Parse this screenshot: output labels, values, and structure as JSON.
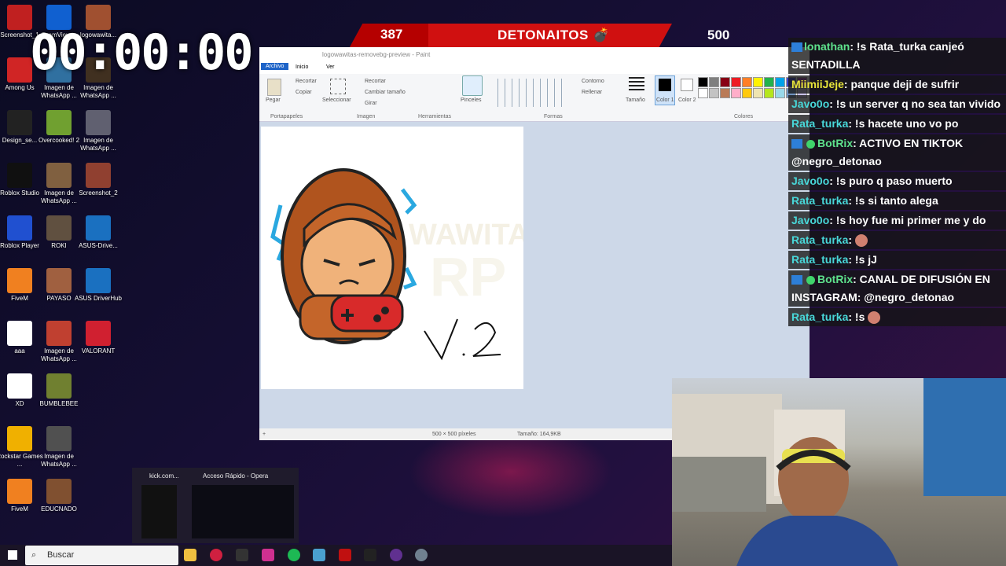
{
  "desktop_icons": [
    {
      "label": "Screenshot_1",
      "color": "#c02020"
    },
    {
      "label": "Among Us",
      "color": "#d02525"
    },
    {
      "label": "Design_se...",
      "color": "#222222"
    },
    {
      "label": "Roblox Studio",
      "color": "#101010"
    },
    {
      "label": "Roblox Player",
      "color": "#2050d0"
    },
    {
      "label": "FiveM",
      "color": "#f08020"
    },
    {
      "label": "aaa",
      "color": "#ffffff"
    },
    {
      "label": "XD",
      "color": "#ffffff"
    },
    {
      "label": "Rockstar Games ...",
      "color": "#f0b000"
    },
    {
      "label": "FiveM",
      "color": "#f08020"
    },
    {
      "label": "TeamViewer",
      "color": "#1060d0"
    },
    {
      "label": "Imagen de WhatsApp ...",
      "color": "#3070a0"
    },
    {
      "label": "Overcooked! 2",
      "color": "#70a030"
    },
    {
      "label": "Imagen de WhatsApp ...",
      "color": "#806040"
    },
    {
      "label": "ROKI",
      "color": "#605040"
    },
    {
      "label": "PAYASO",
      "color": "#a06040"
    },
    {
      "label": "Imagen de WhatsApp ...",
      "color": "#c04030"
    },
    {
      "label": "BUMBLEBEE",
      "color": "#708030"
    },
    {
      "label": "Imagen de WhatsApp ...",
      "color": "#505050"
    },
    {
      "label": "EDUCNADO",
      "color": "#805030"
    },
    {
      "label": "logowawita...",
      "color": "#a05030"
    },
    {
      "label": "Imagen de WhatsApp ...",
      "color": "#403020"
    },
    {
      "label": "Imagen de WhatsApp ...",
      "color": "#606070"
    },
    {
      "label": "Screenshot_2",
      "color": "#904030"
    },
    {
      "label": "ASUS-Drive...",
      "color": "#1a70c0"
    },
    {
      "label": "ASUS DriverHub",
      "color": "#1a70c0"
    },
    {
      "label": "VALORANT",
      "color": "#d02030"
    }
  ],
  "timer": "00:00:00",
  "scorebar": {
    "left": "387",
    "title": "DETONAITOS 💣",
    "right": "500"
  },
  "paint": {
    "title": "logowawitas-removebg-preview - Paint",
    "menu": [
      "Archivo",
      "Inicio",
      "Ver"
    ],
    "groups": [
      "Portapapeles",
      "Imagen",
      "Herramientas",
      "Formas",
      "Colores"
    ],
    "clipboard": {
      "paste": "Pegar",
      "cut": "Recortar",
      "copy": "Copiar"
    },
    "image": {
      "select": "Seleccionar",
      "crop": "Recortar",
      "resize": "Cambiar tamaño",
      "rotate": "Girar"
    },
    "brushes": "Pinceles",
    "outline": "Contorno",
    "fill": "Rellenar",
    "size": "Tamaño",
    "color1": "Color 1",
    "color2": "Color 2",
    "palette": [
      "#000000",
      "#7f7f7f",
      "#880015",
      "#ed1c24",
      "#ff7f27",
      "#fff200",
      "#22b14c",
      "#00a2e8",
      "#3f48cc",
      "#a349a4",
      "#ffffff",
      "#c3c3c3",
      "#b97a57",
      "#ffaec9",
      "#ffc90e",
      "#efe4b0",
      "#b5e61d",
      "#99d9ea",
      "#7092be",
      "#c8bfe7"
    ],
    "status_size": "500 × 500 píxeles",
    "status_file": "Tamaño: 164,9KB",
    "watermark": "WAWITAS RP",
    "handwritten": "V. 2"
  },
  "chat": [
    {
      "user": "lonathan",
      "cls": "g",
      "text": ": !s Rata_turka canjeó SENTADILLA",
      "badge": true
    },
    {
      "user": "MiimiiJeje",
      "cls": "y",
      "text": ": panque deji de sufrir"
    },
    {
      "user": "Javo0o",
      "cls": "c",
      "text": ": !s un server q no sea tan vivido"
    },
    {
      "user": "Rata_turka",
      "cls": "c",
      "text": ": !s hacete uno vo po"
    },
    {
      "user": "BotRix",
      "cls": "g",
      "text": ": ACTIVO EN TIKTOK @negro_detonao",
      "badge": true,
      "check": true
    },
    {
      "user": "Javo0o",
      "cls": "c",
      "text": ": !s puro q paso muerto"
    },
    {
      "user": "Rata_turka",
      "cls": "c",
      "text": ": !s si tanto alega"
    },
    {
      "user": "Javo0o",
      "cls": "c",
      "text": ": !s hoy fue mi primer me y do"
    },
    {
      "user": "Rata_turka",
      "cls": "c",
      "text": ":",
      "emote": true
    },
    {
      "user": "Rata_turka",
      "cls": "c",
      "text": ": !s jJ"
    },
    {
      "user": "BotRix",
      "cls": "g",
      "text": ": CANAL DE DIFUSIÓN EN INSTAGRAM: @negro_detonao",
      "badge": true,
      "check": true
    },
    {
      "user": "Rata_turka",
      "cls": "c",
      "text": ": !s",
      "emote": true
    }
  ],
  "taskbar": {
    "search_placeholder": "Buscar",
    "thumb_1": "kick.com...",
    "thumb_2": "Acceso Rápido - Opera"
  }
}
